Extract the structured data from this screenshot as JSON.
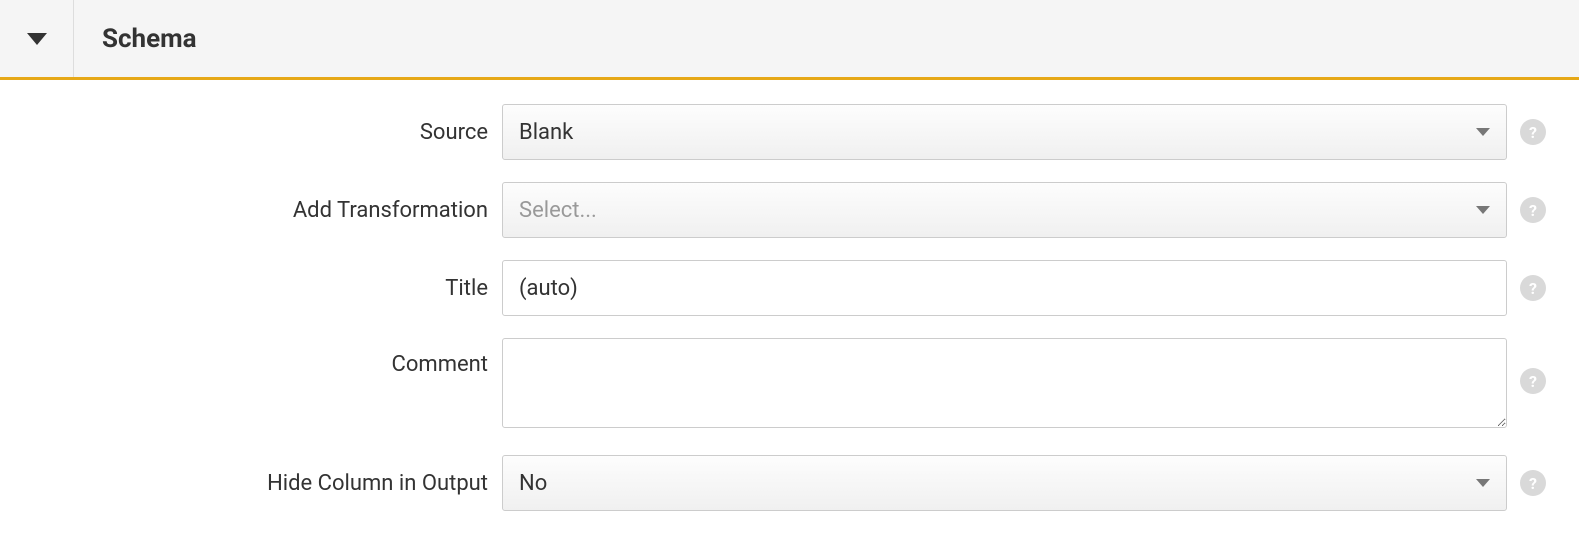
{
  "header": {
    "title": "Schema"
  },
  "form": {
    "source": {
      "label": "Source",
      "value": "Blank"
    },
    "transformation": {
      "label": "Add Transformation",
      "placeholder": "Select..."
    },
    "title": {
      "label": "Title",
      "value": "(auto)"
    },
    "comment": {
      "label": "Comment",
      "value": ""
    },
    "hide": {
      "label": "Hide Column in Output",
      "value": "No"
    }
  },
  "help_glyph": "?"
}
